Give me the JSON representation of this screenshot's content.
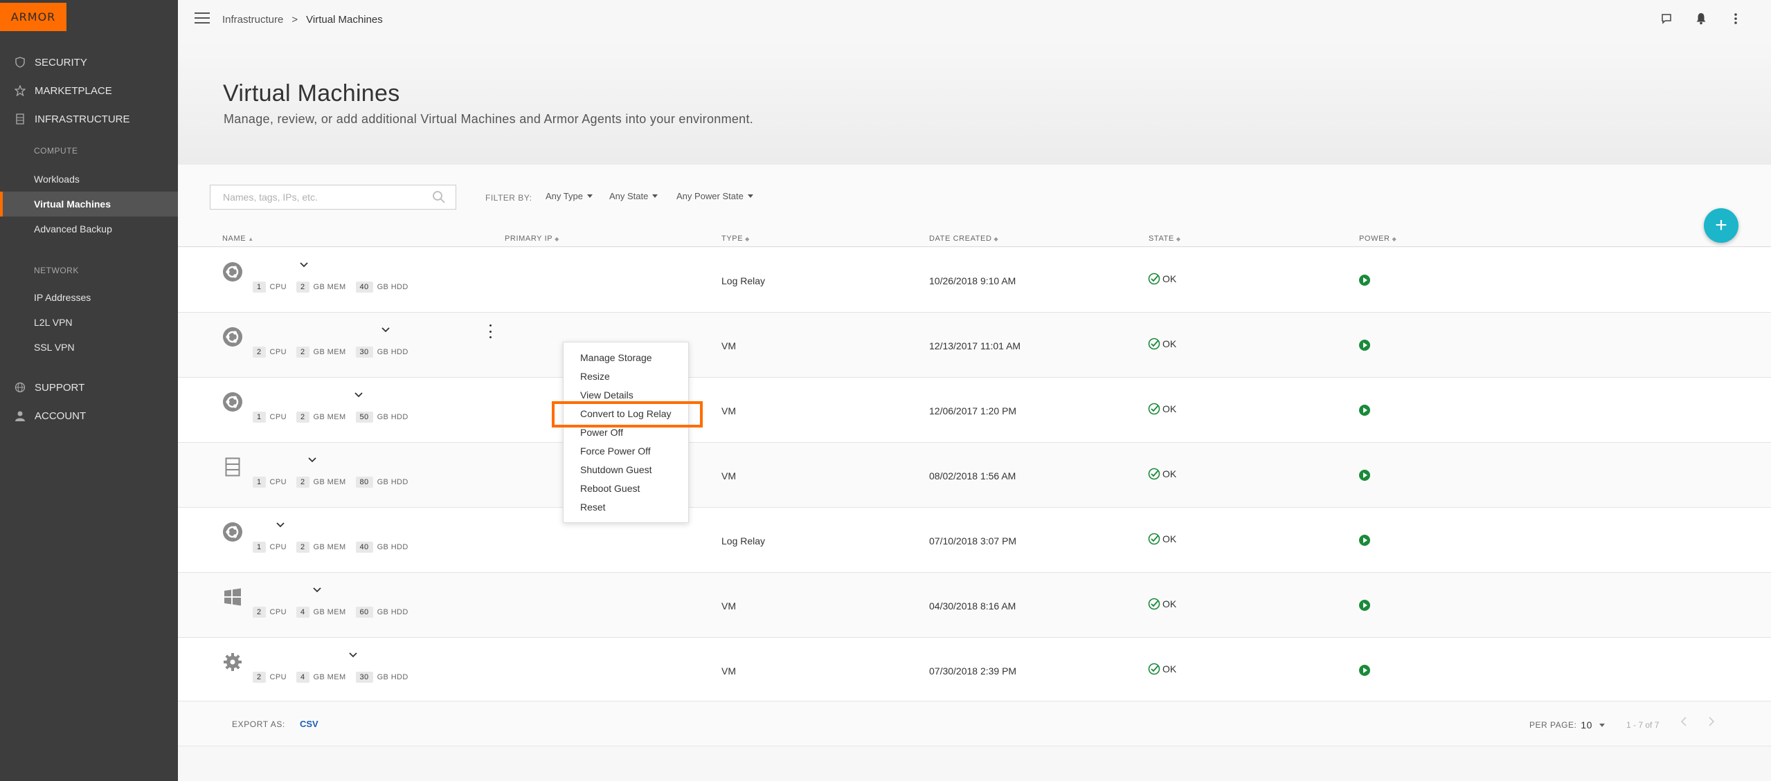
{
  "logo": "ARMOR",
  "sidebar": {
    "sections": [
      {
        "label": "SECURITY"
      },
      {
        "label": "MARKETPLACE"
      },
      {
        "label": "INFRASTRUCTURE"
      }
    ],
    "compute_heading": "COMPUTE",
    "compute_items": [
      "Workloads",
      "Virtual Machines",
      "Advanced Backup"
    ],
    "network_heading": "NETWORK",
    "network_items": [
      "IP Addresses",
      "L2L VPN",
      "SSL VPN"
    ],
    "bottom_sections": [
      {
        "label": "SUPPORT"
      },
      {
        "label": "ACCOUNT"
      }
    ]
  },
  "breadcrumb": {
    "parent": "Infrastructure",
    "sep": ">",
    "current": "Virtual Machines"
  },
  "page": {
    "title": "Virtual Machines",
    "subtitle": "Manage, review, or add additional Virtual Machines and Armor Agents into your environment."
  },
  "search": {
    "placeholder": "Names, tags, IPs, etc.",
    "value": ""
  },
  "filters": {
    "label": "FILTER BY:",
    "type": "Any Type",
    "state": "Any State",
    "power": "Any Power State"
  },
  "fab": "+",
  "columns": [
    "NAME",
    "PRIMARY IP",
    "TYPE",
    "DATE CREATED",
    "STATE",
    "POWER"
  ],
  "sort_glyph": "▲",
  "sort_glyph_neutral": "◆",
  "spec_labels": {
    "cpu": "CPU",
    "mem": "GB MEM",
    "hdd": "GB HDD"
  },
  "rows": [
    {
      "os": "ubuntu",
      "cpu": "1",
      "mem": "2",
      "hdd": "40",
      "type": "Log Relay",
      "date": "10/26/2018 9:10 AM",
      "state": "OK"
    },
    {
      "os": "ubuntu",
      "cpu": "2",
      "mem": "2",
      "hdd": "30",
      "type": "VM",
      "date": "12/13/2017 11:01 AM",
      "state": "OK"
    },
    {
      "os": "ubuntu",
      "cpu": "1",
      "mem": "2",
      "hdd": "50",
      "type": "VM",
      "date": "12/06/2017 1:20 PM",
      "state": "OK"
    },
    {
      "os": "server",
      "cpu": "1",
      "mem": "2",
      "hdd": "80",
      "type": "VM",
      "date": "08/02/2018 1:56 AM",
      "state": "OK"
    },
    {
      "os": "ubuntu",
      "cpu": "1",
      "mem": "2",
      "hdd": "40",
      "type": "Log Relay",
      "date": "07/10/2018 3:07 PM",
      "state": "OK"
    },
    {
      "os": "windows",
      "cpu": "2",
      "mem": "4",
      "hdd": "60",
      "type": "VM",
      "date": "04/30/2018 8:16 AM",
      "state": "OK"
    },
    {
      "os": "gear",
      "cpu": "2",
      "mem": "4",
      "hdd": "30",
      "type": "VM",
      "date": "07/30/2018 2:39 PM",
      "state": "OK"
    }
  ],
  "context_menu": [
    "Manage Storage",
    "Resize",
    "View Details",
    "Convert to Log Relay",
    "Power Off",
    "Force Power Off",
    "Shutdown Guest",
    "Reboot Guest",
    "Reset"
  ],
  "footer": {
    "export_label": "EXPORT AS:",
    "export_link": "CSV",
    "per_page_label": "PER PAGE:",
    "per_page_value": "10",
    "range": "1 - 7 of 7"
  },
  "colors": {
    "brand": "#ff6d00",
    "sidebar": "#3d3d3d",
    "fab": "#1cb5c9",
    "ok": "#1a8a3a",
    "link": "#1a5fb4"
  }
}
